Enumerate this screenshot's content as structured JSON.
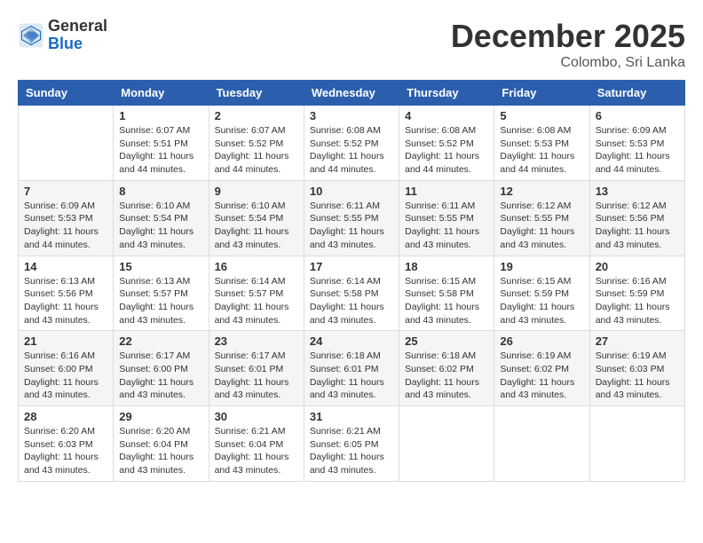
{
  "header": {
    "logo": {
      "general": "General",
      "blue": "Blue"
    },
    "title": "December 2025",
    "location": "Colombo, Sri Lanka"
  },
  "calendar": {
    "days_of_week": [
      "Sunday",
      "Monday",
      "Tuesday",
      "Wednesday",
      "Thursday",
      "Friday",
      "Saturday"
    ],
    "weeks": [
      [
        {
          "day": "",
          "info": ""
        },
        {
          "day": "1",
          "info": "Sunrise: 6:07 AM\nSunset: 5:51 PM\nDaylight: 11 hours and 44 minutes."
        },
        {
          "day": "2",
          "info": "Sunrise: 6:07 AM\nSunset: 5:52 PM\nDaylight: 11 hours and 44 minutes."
        },
        {
          "day": "3",
          "info": "Sunrise: 6:08 AM\nSunset: 5:52 PM\nDaylight: 11 hours and 44 minutes."
        },
        {
          "day": "4",
          "info": "Sunrise: 6:08 AM\nSunset: 5:52 PM\nDaylight: 11 hours and 44 minutes."
        },
        {
          "day": "5",
          "info": "Sunrise: 6:08 AM\nSunset: 5:53 PM\nDaylight: 11 hours and 44 minutes."
        },
        {
          "day": "6",
          "info": "Sunrise: 6:09 AM\nSunset: 5:53 PM\nDaylight: 11 hours and 44 minutes."
        }
      ],
      [
        {
          "day": "7",
          "info": "Sunrise: 6:09 AM\nSunset: 5:53 PM\nDaylight: 11 hours and 44 minutes."
        },
        {
          "day": "8",
          "info": "Sunrise: 6:10 AM\nSunset: 5:54 PM\nDaylight: 11 hours and 43 minutes."
        },
        {
          "day": "9",
          "info": "Sunrise: 6:10 AM\nSunset: 5:54 PM\nDaylight: 11 hours and 43 minutes."
        },
        {
          "day": "10",
          "info": "Sunrise: 6:11 AM\nSunset: 5:55 PM\nDaylight: 11 hours and 43 minutes."
        },
        {
          "day": "11",
          "info": "Sunrise: 6:11 AM\nSunset: 5:55 PM\nDaylight: 11 hours and 43 minutes."
        },
        {
          "day": "12",
          "info": "Sunrise: 6:12 AM\nSunset: 5:55 PM\nDaylight: 11 hours and 43 minutes."
        },
        {
          "day": "13",
          "info": "Sunrise: 6:12 AM\nSunset: 5:56 PM\nDaylight: 11 hours and 43 minutes."
        }
      ],
      [
        {
          "day": "14",
          "info": "Sunrise: 6:13 AM\nSunset: 5:56 PM\nDaylight: 11 hours and 43 minutes."
        },
        {
          "day": "15",
          "info": "Sunrise: 6:13 AM\nSunset: 5:57 PM\nDaylight: 11 hours and 43 minutes."
        },
        {
          "day": "16",
          "info": "Sunrise: 6:14 AM\nSunset: 5:57 PM\nDaylight: 11 hours and 43 minutes."
        },
        {
          "day": "17",
          "info": "Sunrise: 6:14 AM\nSunset: 5:58 PM\nDaylight: 11 hours and 43 minutes."
        },
        {
          "day": "18",
          "info": "Sunrise: 6:15 AM\nSunset: 5:58 PM\nDaylight: 11 hours and 43 minutes."
        },
        {
          "day": "19",
          "info": "Sunrise: 6:15 AM\nSunset: 5:59 PM\nDaylight: 11 hours and 43 minutes."
        },
        {
          "day": "20",
          "info": "Sunrise: 6:16 AM\nSunset: 5:59 PM\nDaylight: 11 hours and 43 minutes."
        }
      ],
      [
        {
          "day": "21",
          "info": "Sunrise: 6:16 AM\nSunset: 6:00 PM\nDaylight: 11 hours and 43 minutes."
        },
        {
          "day": "22",
          "info": "Sunrise: 6:17 AM\nSunset: 6:00 PM\nDaylight: 11 hours and 43 minutes."
        },
        {
          "day": "23",
          "info": "Sunrise: 6:17 AM\nSunset: 6:01 PM\nDaylight: 11 hours and 43 minutes."
        },
        {
          "day": "24",
          "info": "Sunrise: 6:18 AM\nSunset: 6:01 PM\nDaylight: 11 hours and 43 minutes."
        },
        {
          "day": "25",
          "info": "Sunrise: 6:18 AM\nSunset: 6:02 PM\nDaylight: 11 hours and 43 minutes."
        },
        {
          "day": "26",
          "info": "Sunrise: 6:19 AM\nSunset: 6:02 PM\nDaylight: 11 hours and 43 minutes."
        },
        {
          "day": "27",
          "info": "Sunrise: 6:19 AM\nSunset: 6:03 PM\nDaylight: 11 hours and 43 minutes."
        }
      ],
      [
        {
          "day": "28",
          "info": "Sunrise: 6:20 AM\nSunset: 6:03 PM\nDaylight: 11 hours and 43 minutes."
        },
        {
          "day": "29",
          "info": "Sunrise: 6:20 AM\nSunset: 6:04 PM\nDaylight: 11 hours and 43 minutes."
        },
        {
          "day": "30",
          "info": "Sunrise: 6:21 AM\nSunset: 6:04 PM\nDaylight: 11 hours and 43 minutes."
        },
        {
          "day": "31",
          "info": "Sunrise: 6:21 AM\nSunset: 6:05 PM\nDaylight: 11 hours and 43 minutes."
        },
        {
          "day": "",
          "info": ""
        },
        {
          "day": "",
          "info": ""
        },
        {
          "day": "",
          "info": ""
        }
      ]
    ]
  }
}
